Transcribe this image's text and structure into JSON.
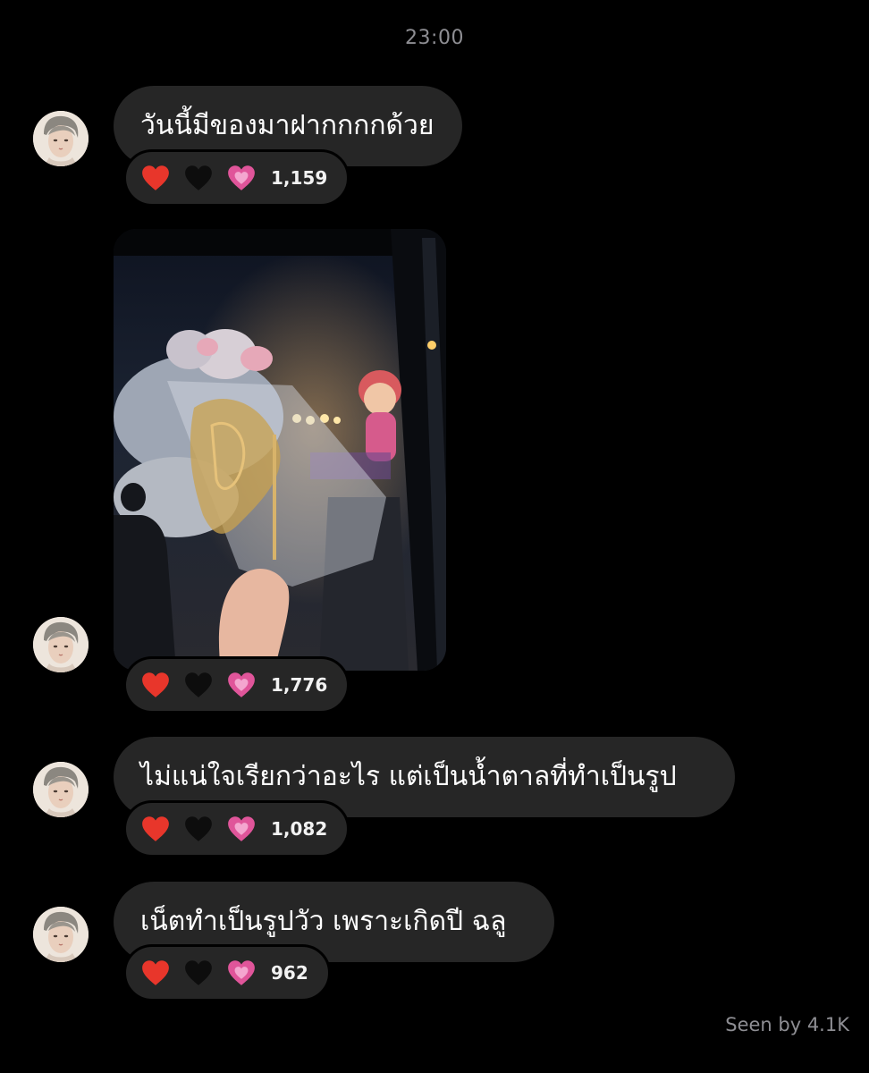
{
  "chat": {
    "timestamp": "23:00",
    "seen_label": "Seen by 4.1K"
  },
  "messages": [
    {
      "type": "text",
      "text": "วันนี้มีของมาฝากกกกด้วย",
      "reactions": [
        "red-heart",
        "black-heart",
        "growing-heart"
      ],
      "reaction_count": "1,159"
    },
    {
      "type": "image",
      "image_description": "photo-candy-ox",
      "reactions": [
        "red-heart",
        "black-heart",
        "growing-heart"
      ],
      "reaction_count": "1,776"
    },
    {
      "type": "text",
      "text": "ไม่แน่ใจเรียกว่าอะไร แต่เป็นน้ำตาลที่ทำเป็นรูป",
      "reactions": [
        "red-heart",
        "black-heart",
        "growing-heart"
      ],
      "reaction_count": "1,082"
    },
    {
      "type": "text",
      "text": "เน็ตทำเป็นรูปวัว เพราะเกิดปี ฉลู",
      "reactions": [
        "red-heart",
        "black-heart",
        "growing-heart"
      ],
      "reaction_count": "962"
    }
  ],
  "colors": {
    "background": "#000000",
    "bubble": "#262626",
    "meta_text": "#8e8e93",
    "red_heart": "#e8362b",
    "growing_heart": "#e0559a"
  }
}
